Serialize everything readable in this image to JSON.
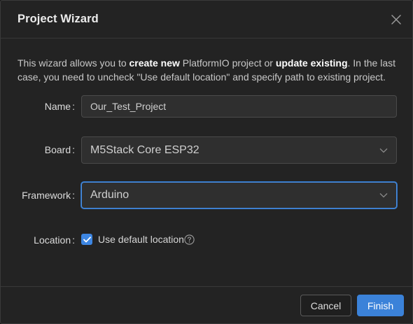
{
  "dialog": {
    "title": "Project Wizard",
    "intro": {
      "part1": "This wizard allows you to ",
      "bold1": "create new",
      "part2": " PlatformIO project or ",
      "bold2": "update existing",
      "part3": ". In the last case, you need to uncheck \"Use default location\" and specify path to existing project."
    }
  },
  "form": {
    "name": {
      "label": "Name",
      "value": "Our_Test_Project"
    },
    "board": {
      "label": "Board",
      "value": "M5Stack Core ESP32"
    },
    "framework": {
      "label": "Framework",
      "value": "Arduino"
    },
    "location": {
      "label": "Location",
      "checkbox_label": "Use default location",
      "checked": true
    }
  },
  "footer": {
    "cancel_label": "Cancel",
    "finish_label": "Finish"
  },
  "colors": {
    "accent": "#3b82d9",
    "background": "#232323"
  },
  "icons": {
    "close": "close-icon",
    "dropdown": "chevron-down-icon",
    "check": "checkmark-icon",
    "help": "question-circle-icon"
  }
}
